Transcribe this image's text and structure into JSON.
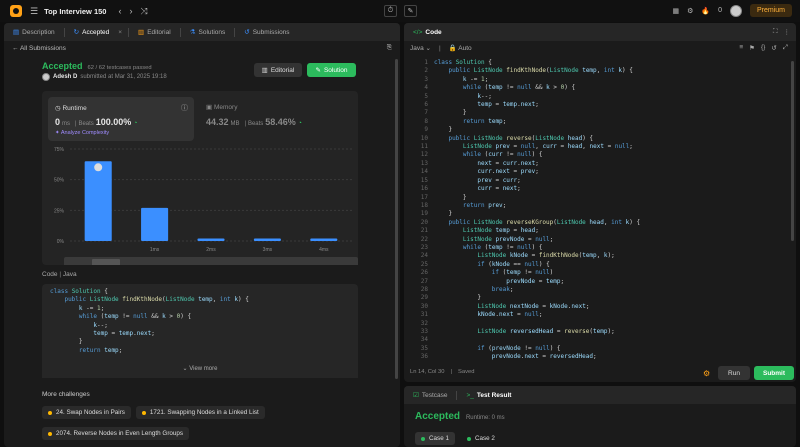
{
  "topbar": {
    "title": "Top Interview 150",
    "fire_count": "0",
    "premium_label": "Premium"
  },
  "left": {
    "tabs": [
      {
        "label": "Description"
      },
      {
        "label": "Accepted"
      },
      {
        "label": "Editorial"
      },
      {
        "label": "Solutions"
      },
      {
        "label": "Submissions"
      }
    ],
    "back_label": "All Submissions",
    "status": "Accepted",
    "testcases": "62 / 62 testcases passed",
    "user": "Adesh D",
    "submitted": "submitted at Mar 31, 2025 19:18",
    "editorial_btn": "Editorial",
    "solution_btn": "Solution",
    "runtime": {
      "label": "Runtime",
      "value": "0",
      "unit": "ms",
      "beats_label": "Beats",
      "beats": "100.00%",
      "analyze": "Analyze Complexity"
    },
    "memory": {
      "label": "Memory",
      "value": "44.32",
      "unit": "MB",
      "beats_label": "Beats",
      "beats": "58.46%"
    },
    "code_label": "Code",
    "code_lang": "Java",
    "view_more": "View more",
    "more_title": "More challenges",
    "challenges": [
      "24. Swap Nodes in Pairs",
      "1721. Swapping Nodes in a Linked List",
      "2074. Reverse Nodes in Even Length Groups"
    ]
  },
  "chart_data": {
    "type": "bar",
    "categories": [
      "",
      "1ms",
      "2ms",
      "3ms",
      "4ms"
    ],
    "values": [
      65,
      27,
      2,
      2,
      2
    ],
    "yticks": [
      "75%",
      "50%",
      "25%",
      "0%"
    ],
    "ylim": [
      0,
      75
    ],
    "highlight_index": 0,
    "bar_color": "#3b8fff"
  },
  "editor": {
    "title": "Code",
    "lang": "Java",
    "mode": "Auto",
    "status_pos": "Ln 14, Col 30",
    "status_saved": "Saved",
    "run_label": "Run",
    "submit_label": "Submit"
  },
  "bottom": {
    "tab1": "Testcase",
    "tab2": "Test Result",
    "result": "Accepted",
    "runtime": "Runtime: 0 ms",
    "cases": [
      "Case 1",
      "Case 2"
    ]
  }
}
